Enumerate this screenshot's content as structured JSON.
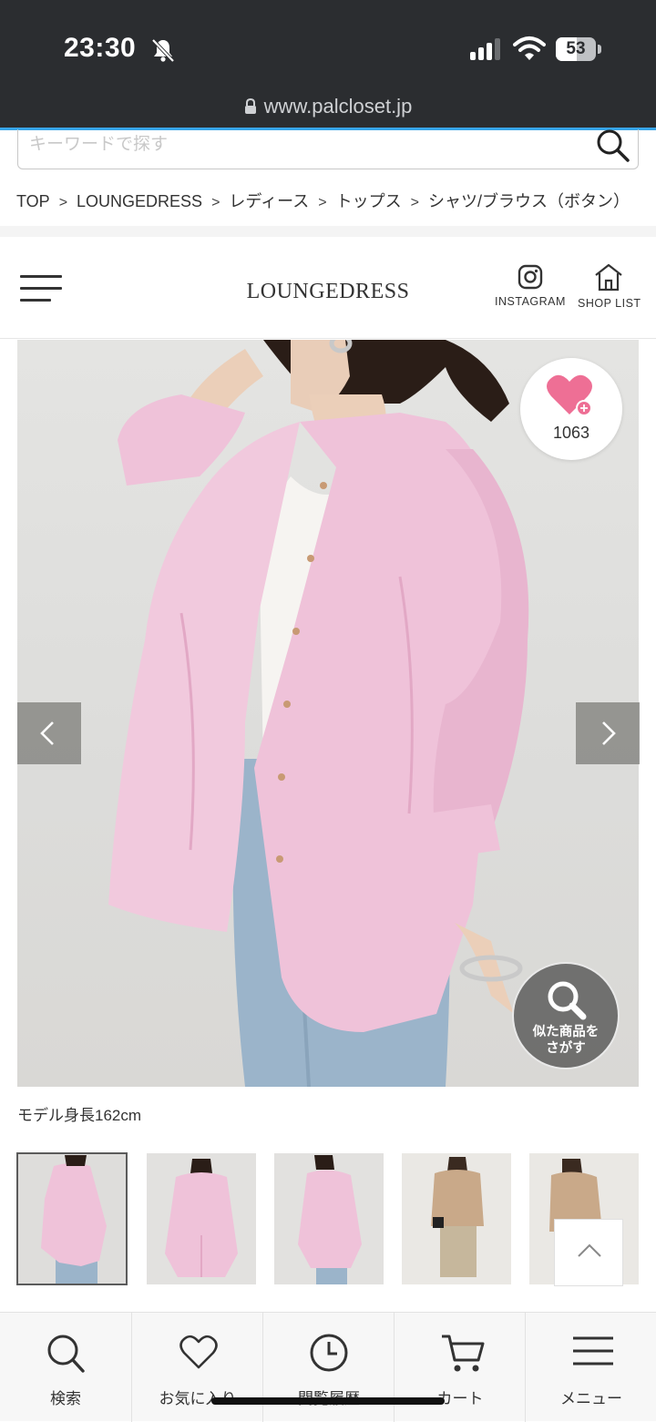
{
  "status_bar": {
    "time": "23:30",
    "battery_level": "53",
    "url": "www.palcloset.jp"
  },
  "search": {
    "placeholder": "キーワードで探す"
  },
  "breadcrumb": {
    "items": [
      "TOP",
      "LOUNGEDRESS",
      "レディース",
      "トップス",
      "シャツ/ブラウス（ボタン）"
    ],
    "separator": ">"
  },
  "header": {
    "logo": "LOUNGEDRESS",
    "instagram_label": "INSTAGRAM",
    "shoplist_label": "SHOP LIST"
  },
  "product": {
    "favorite_count": "1063",
    "similar_label": "似た商品を\nさがす",
    "model_height": "モデル身長162cm"
  },
  "thumbnails": {
    "count": 5,
    "selected_index": 0
  },
  "bottom_nav": {
    "search": "検索",
    "favorites": "お気に入り",
    "history": "閲覧履歴",
    "cart": "カート",
    "menu": "メニュー"
  },
  "colors": {
    "status_bar": "#2b2d30",
    "accent_blue": "#37a5e8",
    "favorite_heart": "#ee6f95",
    "shirt_pink": "#efc2d9",
    "denim": "#9bb4ca"
  }
}
